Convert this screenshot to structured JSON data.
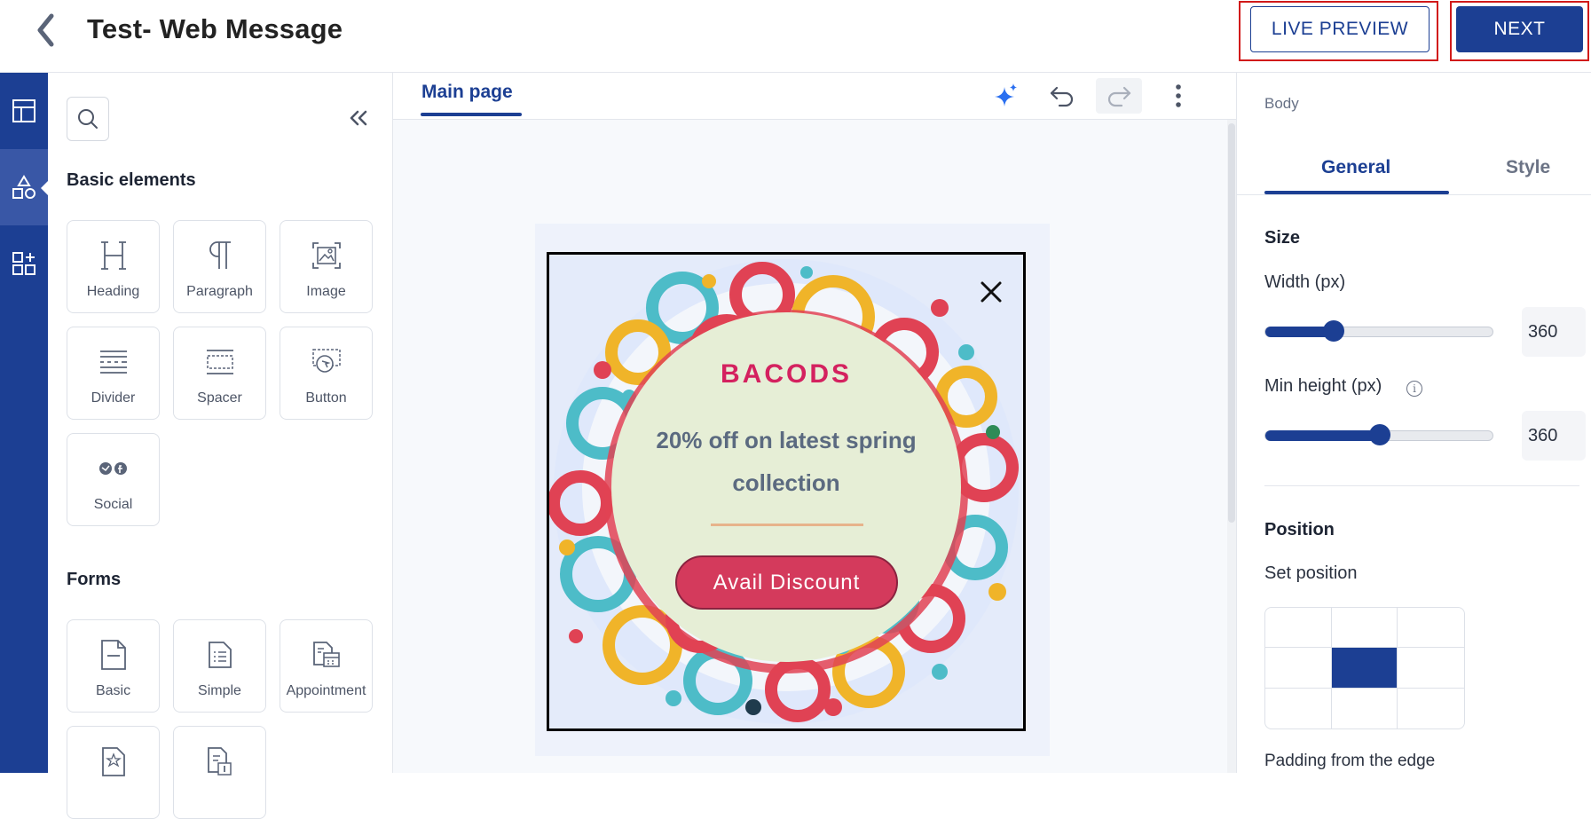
{
  "header": {
    "title": "Test- Web Message",
    "live_preview_label": "LIVE PREVIEW",
    "next_label": "NEXT"
  },
  "rail": {
    "items": [
      {
        "icon": "layout-icon"
      },
      {
        "icon": "shapes-icon",
        "active": true
      },
      {
        "icon": "add-widget-icon"
      }
    ]
  },
  "elements_panel": {
    "basic_title": "Basic elements",
    "basic": [
      {
        "label": "Heading",
        "icon": "heading-icon"
      },
      {
        "label": "Paragraph",
        "icon": "paragraph-icon"
      },
      {
        "label": "Image",
        "icon": "image-icon"
      },
      {
        "label": "Divider",
        "icon": "divider-icon"
      },
      {
        "label": "Spacer",
        "icon": "spacer-icon"
      },
      {
        "label": "Button",
        "icon": "button-icon"
      },
      {
        "label": "Social",
        "icon": "social-icon"
      }
    ],
    "forms_title": "Forms",
    "forms": [
      {
        "label": "Basic",
        "icon": "basic-form-icon"
      },
      {
        "label": "Simple",
        "icon": "simple-form-icon"
      },
      {
        "label": "Appointment",
        "icon": "appointment-form-icon"
      },
      {
        "label": "",
        "icon": "rating-form-icon"
      },
      {
        "label": "",
        "icon": "form-icon"
      }
    ]
  },
  "canvas": {
    "tab_label": "Main page",
    "popup": {
      "brand": "BACODS",
      "headline": "20% off on latest spring collection",
      "cta_label": "Avail Discount",
      "colors": {
        "brand": "#d4215f",
        "cta": "#d43a5c",
        "circle": "#e6eed6"
      }
    }
  },
  "properties": {
    "breadcrumb": "Body",
    "tabs": [
      "General",
      "Style"
    ],
    "active_tab": "General",
    "size_title": "Size",
    "width_label": "Width (px)",
    "width_value": "360",
    "width_fraction": 0.3,
    "min_height_label": "Min height (px)",
    "min_height_value": "360",
    "min_height_fraction": 0.5,
    "position_title": "Position",
    "set_position_label": "Set position",
    "position_selected": "center",
    "padding_label": "Padding from the edge"
  },
  "colors": {
    "primary": "#1c3f93",
    "highlight": "#d11a1a"
  }
}
